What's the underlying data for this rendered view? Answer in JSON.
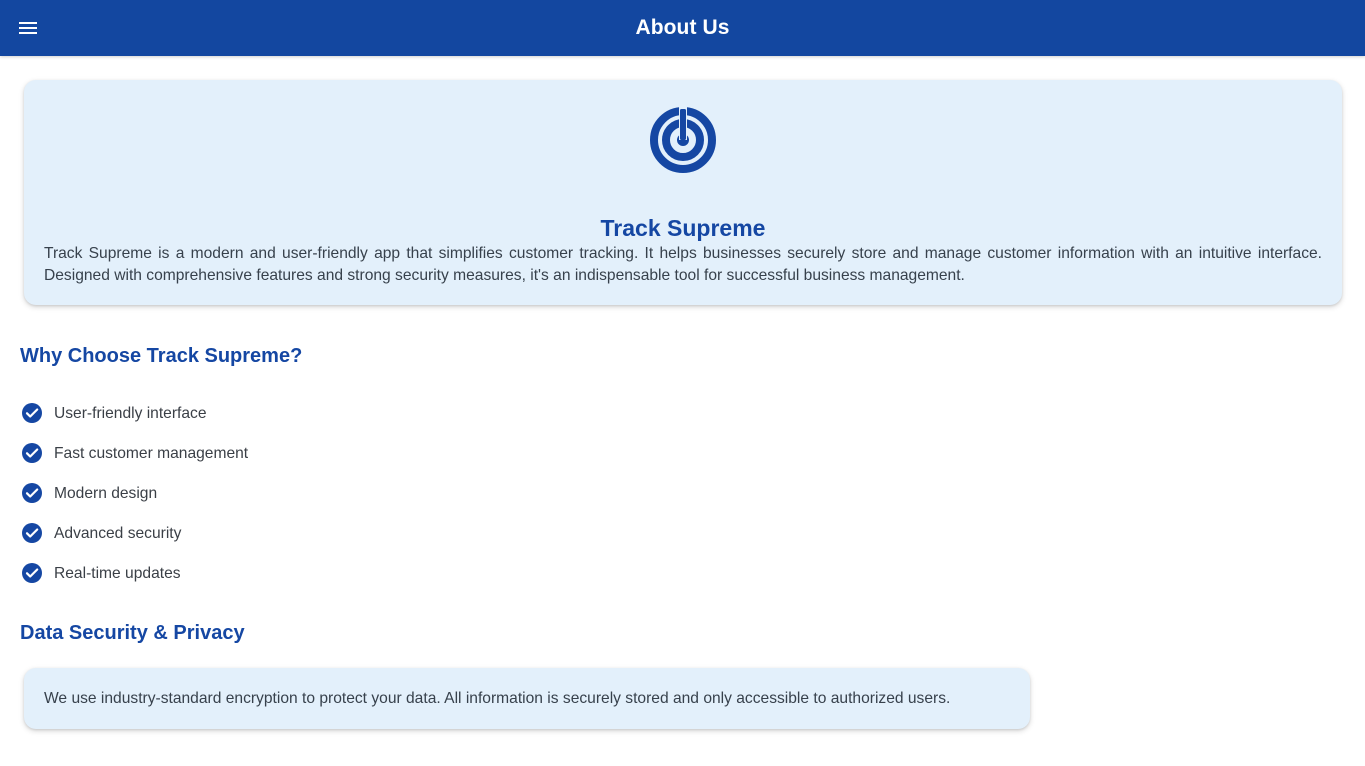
{
  "app_bar": {
    "title": "About Us",
    "menu_icon": "menu-icon",
    "background_color": "#1347a0",
    "title_color": "#ffffff"
  },
  "hero": {
    "icon": "track-changes-icon",
    "title": "Track Supreme",
    "description": "Track Supreme is a modern and user-friendly app that simplifies customer tracking. It helps businesses securely store and manage customer information with an intuitive interface. Designed with comprehensive features and strong security measures, it's an indispensable tool for successful business management.",
    "background_color": "#e3f0fb",
    "accent_color": "#1547a3"
  },
  "why_choose": {
    "heading": "Why Choose Track Supreme?",
    "items": [
      {
        "icon": "check-circle-icon",
        "label": "User-friendly interface"
      },
      {
        "icon": "check-circle-icon",
        "label": "Fast customer management"
      },
      {
        "icon": "check-circle-icon",
        "label": "Modern design"
      },
      {
        "icon": "check-circle-icon",
        "label": "Advanced security"
      },
      {
        "icon": "check-circle-icon",
        "label": "Real-time updates"
      }
    ]
  },
  "privacy": {
    "heading": "Data Security & Privacy",
    "text": "We use industry-standard encryption to protect your data. All information is securely stored and only accessible to authorized users."
  }
}
